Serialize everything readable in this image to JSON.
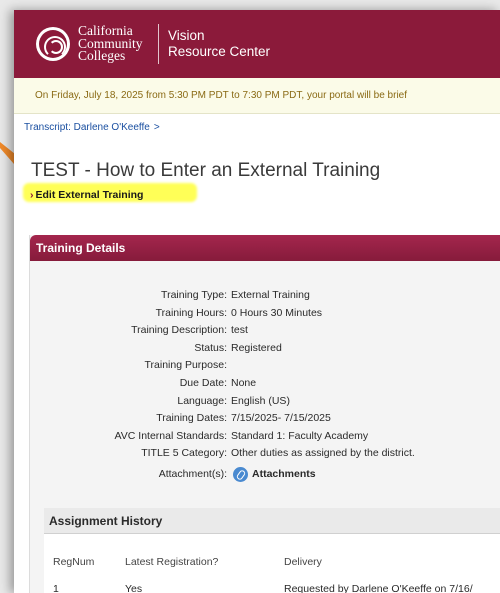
{
  "header": {
    "org_line1": "California",
    "org_line2": "Community",
    "org_line3": "Colleges",
    "site_line1": "Vision",
    "site_line2": "Resource Center"
  },
  "notice": "On Friday, July 18, 2025 from 5:30 PM PDT to 7:30 PM PDT, your portal will be brief",
  "breadcrumb": {
    "label": "Transcript: Darlene O'Keeffe",
    "chevron": ">"
  },
  "page_title": "TEST - How to Enter an External Training",
  "edit_link": {
    "arrow": "›",
    "label": "Edit External Training"
  },
  "training_details": {
    "header": "Training Details",
    "fields": [
      {
        "label": "Training Type:",
        "value": "External Training"
      },
      {
        "label": "Training Hours:",
        "value": "0 Hours 30 Minutes"
      },
      {
        "label": "Training Description:",
        "value": "test"
      },
      {
        "label": "Status:",
        "value": "Registered"
      },
      {
        "label": "Training Purpose:",
        "value": ""
      },
      {
        "label": "Due Date:",
        "value": "None"
      },
      {
        "label": "Language:",
        "value": "English (US)"
      },
      {
        "label": "Training Dates:",
        "value": "7/15/2025- 7/15/2025"
      },
      {
        "label": "AVC Internal Standards:",
        "value": "Standard 1: Faculty Academy"
      },
      {
        "label": "TITLE 5 Category:",
        "value": "Other duties as assigned by the district."
      }
    ],
    "attachments": {
      "label": "Attachment(s):",
      "link": "Attachments",
      "icon": "paperclip-icon"
    }
  },
  "assignment_history": {
    "header": "Assignment History",
    "columns": [
      "RegNum",
      "Latest Registration?",
      "Delivery"
    ],
    "rows": [
      [
        "1",
        "Yes",
        "Requested by Darlene O'Keeffe on 7/16/"
      ]
    ]
  },
  "colors": {
    "brand": "#8b1a3a",
    "notice_text": "#8a6a14",
    "link": "#1a4fa0",
    "highlight": "#ffff3a",
    "pointer": "#f08a2a"
  }
}
